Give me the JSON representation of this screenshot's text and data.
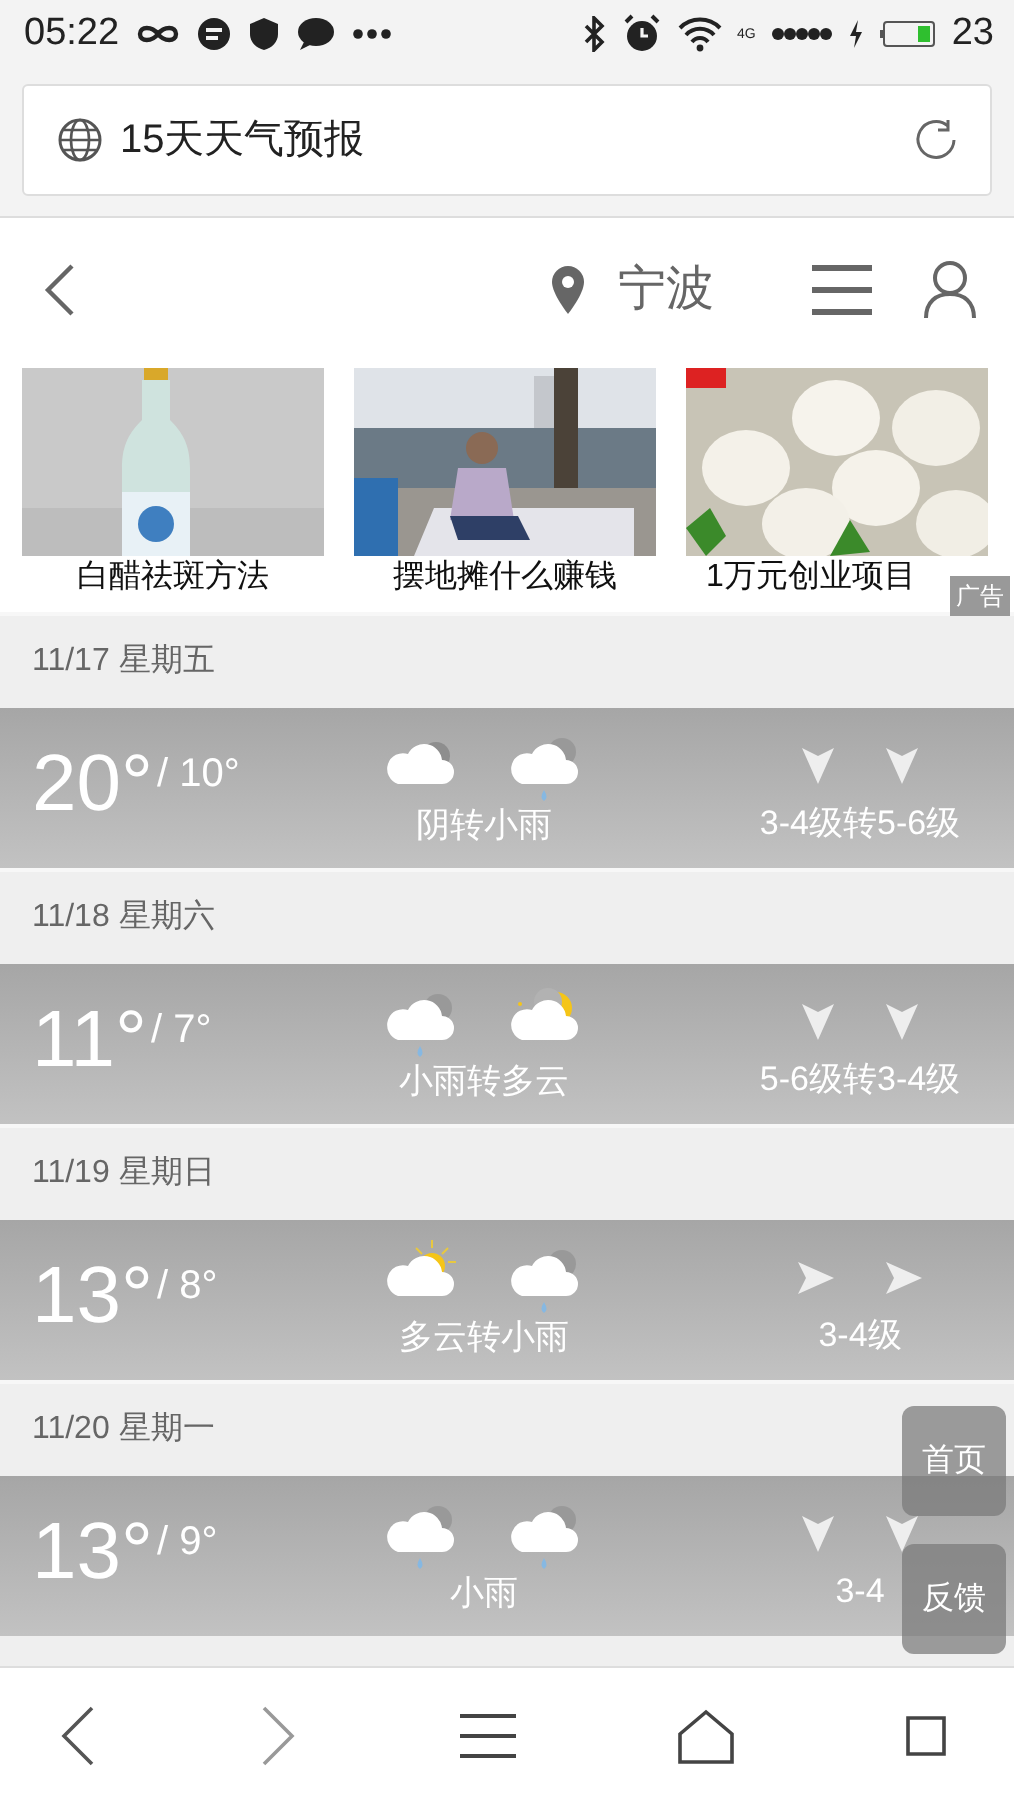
{
  "status_bar": {
    "time": "05:22",
    "network": "4G",
    "battery_text": "23"
  },
  "address_bar": {
    "title": "15天天气预报"
  },
  "header": {
    "city": "宁波"
  },
  "ads": [
    {
      "kind": "picture",
      "caption": "白醋祛斑方法"
    },
    {
      "kind": "picture",
      "caption": "摆地摊什么赚钱"
    },
    {
      "kind": "picture",
      "caption": "1万元创业项目"
    }
  ],
  "ad_badge": "广告",
  "days": [
    {
      "date": "11/17 星期五",
      "high": "20°",
      "low": "/ 10°",
      "icons": [
        {
          "kind": "overcast"
        },
        {
          "kind": "rain"
        }
      ],
      "condition": "阴转小雨",
      "wind_arrows": [
        {
          "kind": "down"
        },
        {
          "kind": "down"
        }
      ],
      "wind": "3-4级转5-6级"
    },
    {
      "date": "11/18 星期六",
      "high": "11°",
      "low": "/ 7°",
      "icons": [
        {
          "kind": "rain"
        },
        {
          "kind": "cloudy-night"
        }
      ],
      "condition": "小雨转多云",
      "wind_arrows": [
        {
          "kind": "down"
        },
        {
          "kind": "down"
        }
      ],
      "wind": "5-6级转3-4级"
    },
    {
      "date": "11/19 星期日",
      "high": "13°",
      "low": "/ 8°",
      "icons": [
        {
          "kind": "cloudy-day"
        },
        {
          "kind": "rain"
        }
      ],
      "condition": "多云转小雨",
      "wind_arrows": [
        {
          "kind": "right"
        },
        {
          "kind": "right"
        }
      ],
      "wind": "3-4级"
    },
    {
      "date": "11/20 星期一",
      "high": "13°",
      "low": "/ 9°",
      "icons": [
        {
          "kind": "rain"
        },
        {
          "kind": "rain"
        }
      ],
      "condition": "小雨",
      "wind_arrows": [
        {
          "kind": "down"
        },
        {
          "kind": "down"
        }
      ],
      "wind": "3-4"
    }
  ],
  "floating_buttons": [
    "首页",
    "反馈"
  ]
}
